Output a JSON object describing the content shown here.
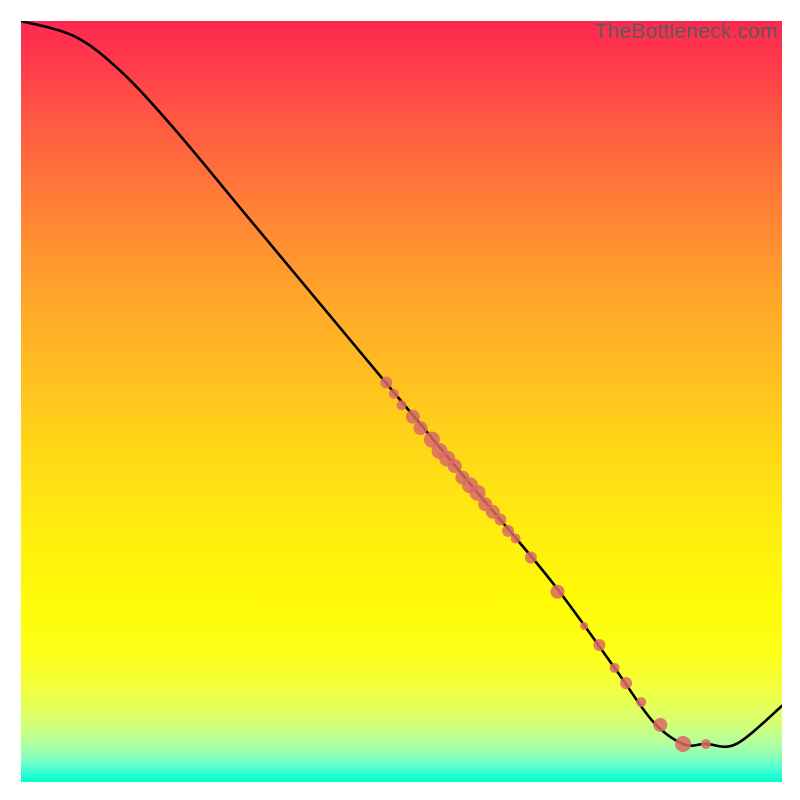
{
  "watermark": "TheBottleneck.com",
  "chart_data": {
    "type": "line",
    "title": "",
    "xlabel": "",
    "ylabel": "",
    "xlim": [
      0,
      100
    ],
    "ylim": [
      0,
      100
    ],
    "line": {
      "name": "bottleneck-curve",
      "points": [
        {
          "x": 0,
          "y": 100
        },
        {
          "x": 7,
          "y": 98
        },
        {
          "x": 13,
          "y": 93.5
        },
        {
          "x": 20,
          "y": 86
        },
        {
          "x": 30,
          "y": 74
        },
        {
          "x": 40,
          "y": 62
        },
        {
          "x": 50,
          "y": 50
        },
        {
          "x": 60,
          "y": 38
        },
        {
          "x": 70,
          "y": 26
        },
        {
          "x": 78,
          "y": 15
        },
        {
          "x": 83,
          "y": 8
        },
        {
          "x": 87,
          "y": 5
        },
        {
          "x": 90,
          "y": 5
        },
        {
          "x": 94,
          "y": 5
        },
        {
          "x": 100,
          "y": 10
        }
      ]
    },
    "scatter": {
      "name": "sample-points",
      "color": "#d96a66",
      "points": [
        {
          "x": 48,
          "y": 52.5,
          "r": 6
        },
        {
          "x": 49,
          "y": 51,
          "r": 5
        },
        {
          "x": 50,
          "y": 49.5,
          "r": 5
        },
        {
          "x": 51.5,
          "y": 48,
          "r": 7
        },
        {
          "x": 52.5,
          "y": 46.5,
          "r": 7
        },
        {
          "x": 54,
          "y": 45,
          "r": 8
        },
        {
          "x": 55,
          "y": 43.5,
          "r": 8
        },
        {
          "x": 56,
          "y": 42.5,
          "r": 8
        },
        {
          "x": 57,
          "y": 41.5,
          "r": 7
        },
        {
          "x": 58,
          "y": 40,
          "r": 7
        },
        {
          "x": 59,
          "y": 39,
          "r": 8
        },
        {
          "x": 60,
          "y": 38,
          "r": 8
        },
        {
          "x": 61,
          "y": 36.5,
          "r": 7
        },
        {
          "x": 62,
          "y": 35.5,
          "r": 7
        },
        {
          "x": 63,
          "y": 34.5,
          "r": 6
        },
        {
          "x": 64,
          "y": 33,
          "r": 6
        },
        {
          "x": 65,
          "y": 32,
          "r": 5
        },
        {
          "x": 67,
          "y": 29.5,
          "r": 6
        },
        {
          "x": 70.5,
          "y": 25,
          "r": 7
        },
        {
          "x": 74,
          "y": 20.5,
          "r": 4
        },
        {
          "x": 76,
          "y": 18,
          "r": 6
        },
        {
          "x": 78,
          "y": 15,
          "r": 5
        },
        {
          "x": 79.5,
          "y": 13,
          "r": 6
        },
        {
          "x": 81.5,
          "y": 10.5,
          "r": 5
        },
        {
          "x": 84,
          "y": 7.5,
          "r": 7
        },
        {
          "x": 87,
          "y": 5,
          "r": 8
        },
        {
          "x": 90,
          "y": 5,
          "r": 5
        }
      ]
    }
  }
}
